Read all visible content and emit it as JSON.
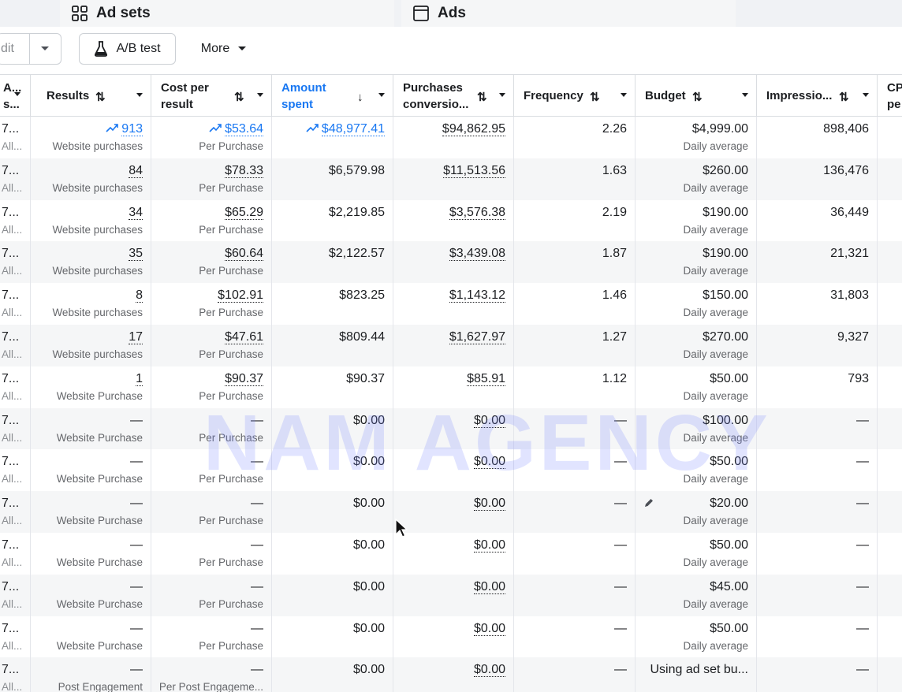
{
  "tabs": {
    "adsets": "Ad sets",
    "ads": "Ads"
  },
  "toolbar": {
    "edit": "dit",
    "ab_test": "A/B test",
    "more": "More"
  },
  "columns": {
    "c0": {
      "line1": "A...",
      "line2": "s..."
    },
    "results": "Results",
    "cost": {
      "line1": "Cost per",
      "line2": "result"
    },
    "amount": {
      "line1": "Amount",
      "line2": "spent"
    },
    "purchases": {
      "line1": "Purchases",
      "line2": "conversio..."
    },
    "frequency": "Frequency",
    "budget": "Budget",
    "impressions": "Impressio...",
    "cpm": {
      "line1": "CP",
      "line2": "pe"
    }
  },
  "rows": [
    {
      "a": "7...",
      "b": "All...",
      "results": "913",
      "results_sub": "Website purchases",
      "cost": "$53.64",
      "cost_sub": "Per Purchase",
      "spent": "$48,977.41",
      "purch": "$94,862.95",
      "freq": "2.26",
      "budget": "$4,999.00",
      "budget_sub": "Daily average",
      "impr": "898,406"
    },
    {
      "a": "7...",
      "b": "All...",
      "results": "84",
      "results_sub": "Website purchases",
      "cost": "$78.33",
      "cost_sub": "Per Purchase",
      "spent": "$6,579.98",
      "purch": "$11,513.56",
      "freq": "1.63",
      "budget": "$260.00",
      "budget_sub": "Daily average",
      "impr": "136,476"
    },
    {
      "a": "7...",
      "b": "All...",
      "results": "34",
      "results_sub": "Website purchases",
      "cost": "$65.29",
      "cost_sub": "Per Purchase",
      "spent": "$2,219.85",
      "purch": "$3,576.38",
      "freq": "2.19",
      "budget": "$190.00",
      "budget_sub": "Daily average",
      "impr": "36,449"
    },
    {
      "a": "7...",
      "b": "All...",
      "results": "35",
      "results_sub": "Website purchases",
      "cost": "$60.64",
      "cost_sub": "Per Purchase",
      "spent": "$2,122.57",
      "purch": "$3,439.08",
      "freq": "1.87",
      "budget": "$190.00",
      "budget_sub": "Daily average",
      "impr": "21,321"
    },
    {
      "a": "7...",
      "b": "All...",
      "results": "8",
      "results_sub": "Website purchases",
      "cost": "$102.91",
      "cost_sub": "Per Purchase",
      "spent": "$823.25",
      "purch": "$1,143.12",
      "freq": "1.46",
      "budget": "$150.00",
      "budget_sub": "Daily average",
      "impr": "31,803"
    },
    {
      "a": "7...",
      "b": "All...",
      "results": "17",
      "results_sub": "Website purchases",
      "cost": "$47.61",
      "cost_sub": "Per Purchase",
      "spent": "$809.44",
      "purch": "$1,627.97",
      "freq": "1.27",
      "budget": "$270.00",
      "budget_sub": "Daily average",
      "impr": "9,327"
    },
    {
      "a": "7...",
      "b": "All...",
      "results": "1",
      "results_sub": "Website Purchase",
      "cost": "$90.37",
      "cost_sub": "Per Purchase",
      "spent": "$90.37",
      "purch": "$85.91",
      "freq": "1.12",
      "budget": "$50.00",
      "budget_sub": "Daily average",
      "impr": "793"
    },
    {
      "a": "7...",
      "b": "All...",
      "results": "—",
      "results_sub": "Website Purchase",
      "cost": "—",
      "cost_sub": "Per Purchase",
      "spent": "$0.00",
      "purch": "$0.00",
      "freq": "—",
      "budget": "$100.00",
      "budget_sub": "Daily average",
      "impr": "—"
    },
    {
      "a": "7...",
      "b": "All...",
      "results": "—",
      "results_sub": "Website Purchase",
      "cost": "—",
      "cost_sub": "Per Purchase",
      "spent": "$0.00",
      "purch": "$0.00",
      "freq": "—",
      "budget": "$50.00",
      "budget_sub": "Daily average",
      "impr": "—"
    },
    {
      "a": "7...",
      "b": "All...",
      "results": "—",
      "results_sub": "Website Purchase",
      "cost": "—",
      "cost_sub": "Per Purchase",
      "spent": "$0.00",
      "purch": "$0.00",
      "freq": "—",
      "budget": "$20.00",
      "budget_sub": "Daily average",
      "impr": "—"
    },
    {
      "a": "7...",
      "b": "All...",
      "results": "—",
      "results_sub": "Website Purchase",
      "cost": "—",
      "cost_sub": "Per Purchase",
      "spent": "$0.00",
      "purch": "$0.00",
      "freq": "—",
      "budget": "$50.00",
      "budget_sub": "Daily average",
      "impr": "—"
    },
    {
      "a": "7...",
      "b": "All...",
      "results": "—",
      "results_sub": "Website Purchase",
      "cost": "—",
      "cost_sub": "Per Purchase",
      "spent": "$0.00",
      "purch": "$0.00",
      "freq": "—",
      "budget": "$45.00",
      "budget_sub": "Daily average",
      "impr": "—"
    },
    {
      "a": "7...",
      "b": "All...",
      "results": "—",
      "results_sub": "Website Purchase",
      "cost": "—",
      "cost_sub": "Per Purchase",
      "spent": "$0.00",
      "purch": "$0.00",
      "freq": "—",
      "budget": "$50.00",
      "budget_sub": "Daily average",
      "impr": "—"
    },
    {
      "a": "7...",
      "b": "All...",
      "results": "—",
      "results_sub": "Post Engagement",
      "cost": "—",
      "cost_sub": "Per Post Engageme...",
      "spent": "$0.00",
      "purch": "$0.00",
      "freq": "—",
      "budget": "Using ad set bu...",
      "budget_sub": "",
      "impr": "—"
    }
  ],
  "watermark": "NAM AGENCY",
  "colors": {
    "accent": "#1877f2",
    "alt_row": "#f5f6f7",
    "border": "#dadde1",
    "watermark": "#7882ff"
  }
}
